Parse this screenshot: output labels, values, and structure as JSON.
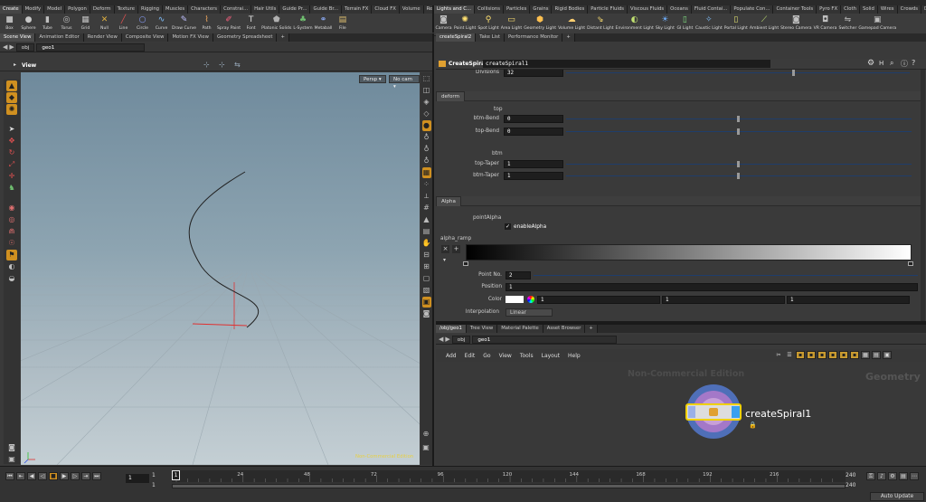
{
  "shelf_tabs_left": [
    "Create",
    "Modify",
    "Model",
    "Polygon",
    "Deform",
    "Texture",
    "Rigging",
    "Muscles",
    "Characters",
    "Constrai...",
    "Hair Utils",
    "Guide Pr...",
    "Guide Br...",
    "Terrain FX",
    "Cloud FX",
    "Volume",
    "Redshift"
  ],
  "shelf_tabs_right": [
    "Lights and C...",
    "Collisions",
    "Particles",
    "Grains",
    "Rigid Bodies",
    "Particle Fluids",
    "Viscous Fluids",
    "Oceans",
    "Fluid Contai...",
    "Populate Con...",
    "Container Tools",
    "Pyro FX",
    "Cloth",
    "Solid",
    "Wires",
    "Crowds",
    "Drive Simula..."
  ],
  "tools_left": [
    {
      "label": "Box",
      "icon": "box-icon",
      "glyph": "■",
      "color": "#b8b8b8"
    },
    {
      "label": "Sphere",
      "icon": "sphere-icon",
      "glyph": "●",
      "color": "#c8c8c8"
    },
    {
      "label": "Tube",
      "icon": "tube-icon",
      "glyph": "▮",
      "color": "#c0c0c0"
    },
    {
      "label": "Torus",
      "icon": "torus-icon",
      "glyph": "◎",
      "color": "#c0c0c0"
    },
    {
      "label": "Grid",
      "icon": "grid-icon",
      "glyph": "▦",
      "color": "#c0c0c0"
    },
    {
      "label": "Null",
      "icon": "null-icon",
      "glyph": "✕",
      "color": "#e0b040"
    },
    {
      "label": "Line",
      "icon": "line-icon",
      "glyph": "╱",
      "color": "#e05050"
    },
    {
      "label": "Circle",
      "icon": "circle-icon",
      "glyph": "○",
      "color": "#8aa0ff"
    },
    {
      "label": "Curve",
      "icon": "curve-icon",
      "glyph": "∿",
      "color": "#80c0ff"
    },
    {
      "label": "Draw Curve",
      "icon": "draw-curve-icon",
      "glyph": "✎",
      "color": "#c0c0ff"
    },
    {
      "label": "Path",
      "icon": "path-icon",
      "glyph": "⌇",
      "color": "#ffb060"
    },
    {
      "label": "Spray Paint",
      "icon": "spray-paint-icon",
      "glyph": "✐",
      "color": "#ff6080"
    },
    {
      "label": "Font",
      "icon": "font-icon",
      "glyph": "T",
      "color": "#e0e0e0"
    },
    {
      "label": "Platonic Solids",
      "icon": "platonic-solids-icon",
      "glyph": "⬟",
      "color": "#b0b0b0"
    },
    {
      "label": "L-System",
      "icon": "l-system-icon",
      "glyph": "♣",
      "color": "#70c070"
    },
    {
      "label": "Metaball",
      "icon": "metaball-icon",
      "glyph": "⚭",
      "color": "#90b0ff"
    },
    {
      "label": "File",
      "icon": "file-icon",
      "glyph": "▤",
      "color": "#e0c070"
    }
  ],
  "tools_right": [
    {
      "label": "Camera",
      "icon": "camera-icon",
      "glyph": "◙",
      "color": "#c0c0c0"
    },
    {
      "label": "Point Light",
      "icon": "point-light-icon",
      "glyph": "✺",
      "color": "#ffe070"
    },
    {
      "label": "Spot Light",
      "icon": "spot-light-icon",
      "glyph": "⚲",
      "color": "#ffe070"
    },
    {
      "label": "Area Light",
      "icon": "area-light-icon",
      "glyph": "▭",
      "color": "#ffe070"
    },
    {
      "label": "Geometry Light",
      "icon": "geometry-light-icon",
      "glyph": "⬢",
      "color": "#ffc050"
    },
    {
      "label": "Volume Light",
      "icon": "volume-light-icon",
      "glyph": "☁",
      "color": "#ffd070"
    },
    {
      "label": "Distant Light",
      "icon": "distant-light-icon",
      "glyph": "⇘",
      "color": "#ffe070"
    },
    {
      "label": "Environment Light",
      "icon": "environment-light-icon",
      "glyph": "◐",
      "color": "#c0e070"
    },
    {
      "label": "Sky Light",
      "icon": "sky-light-icon",
      "glyph": "☀",
      "color": "#70b0ff"
    },
    {
      "label": "GI Light",
      "icon": "gi-light-icon",
      "glyph": "▯",
      "color": "#80e080"
    },
    {
      "label": "Caustic Light",
      "icon": "caustic-light-icon",
      "glyph": "✧",
      "color": "#80c0ff"
    },
    {
      "label": "Portal Light",
      "icon": "portal-light-icon",
      "glyph": "▯",
      "color": "#e0e070"
    },
    {
      "label": "Ambient Light",
      "icon": "ambient-light-icon",
      "glyph": "⟋",
      "color": "#c0e070"
    },
    {
      "label": "Stereo Camera",
      "icon": "stereo-camera-icon",
      "glyph": "◙",
      "color": "#c0c0c0"
    },
    {
      "label": "VR Camera",
      "icon": "vr-camera-icon",
      "glyph": "◘",
      "color": "#c0c0c0"
    },
    {
      "label": "Switcher",
      "icon": "switcher-icon",
      "glyph": "⇋",
      "color": "#c0c0c0"
    },
    {
      "label": "Gamepad Camera",
      "icon": "gamepad-camera-icon",
      "glyph": "▣",
      "color": "#c0c0c0"
    }
  ],
  "left_pane": {
    "tabs": [
      "Scene View",
      "Animation Editor",
      "Render View",
      "Composite View",
      "Motion FX View",
      "Geometry Spreadsheet"
    ],
    "path": [
      "obj",
      "geo1"
    ],
    "viewport_title": "View",
    "persp": "Persp",
    "cam": "No cam",
    "watermark": "Non-Commercial Edition"
  },
  "param_pane": {
    "tabs": [
      "createSpiral2",
      "Take List",
      "Performance Monitor"
    ],
    "node_type": "CreateSpiral",
    "node_name": "createSpiral1",
    "divisions_label": "Divisions",
    "divisions_value": "32",
    "deform_tab": "deform",
    "top_header": "top",
    "btm_bend_label": "btm-Bend",
    "btm_bend_value": "0",
    "top_bend_label": "top-Bend",
    "top_bend_value": "0",
    "btm_header": "btm",
    "top_taper_label": "top-Taper",
    "top_taper_value": "1",
    "btm_taper_label": "btm-Taper",
    "btm_taper_value": "1",
    "alpha_tab": "Alpha",
    "point_alpha_label": "pointAlpha",
    "enable_alpha_label": "enableAlpha",
    "alpha_ramp_label": "alpha_ramp",
    "point_no_label": "Point No.",
    "point_no_value": "2",
    "position_label": "Position",
    "position_value": "1",
    "color_label": "Color",
    "color_r": "1",
    "color_g": "1",
    "color_b": "1",
    "interp_label": "Interpolation",
    "interp_value": "Linear"
  },
  "network_pane": {
    "tabs": [
      "/obj/geo1",
      "Tree View",
      "Material Palette",
      "Asset Browser"
    ],
    "path": [
      "obj",
      "geo1"
    ],
    "menus": [
      "Add",
      "Edit",
      "Go",
      "View",
      "Tools",
      "Layout",
      "Help"
    ],
    "watermark": "Non-Commercial Edition",
    "context": "Geometry",
    "node_label": "createSpiral1"
  },
  "timeline": {
    "frame": "1",
    "start": "1",
    "start2": "1",
    "ticks": [
      "24",
      "48",
      "72",
      "96",
      "120",
      "144",
      "168",
      "192",
      "216"
    ],
    "end": "240",
    "end2": "240",
    "auto_update": "Auto Update"
  }
}
